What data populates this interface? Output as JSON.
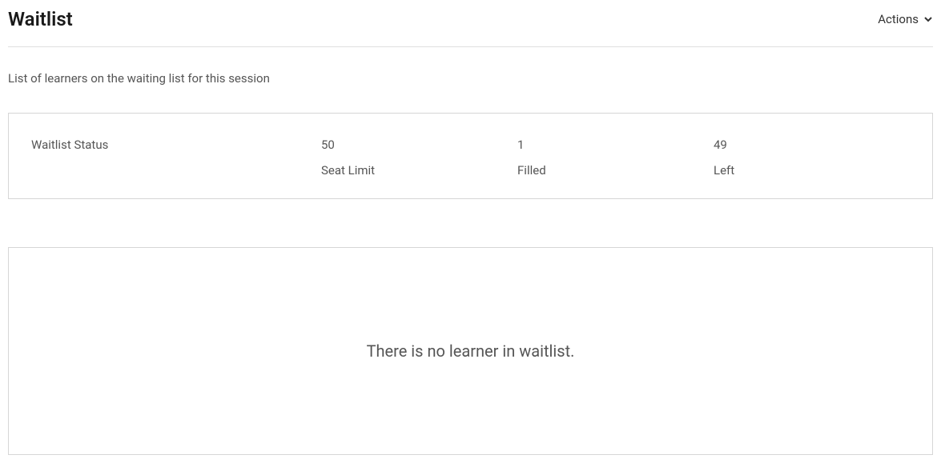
{
  "header": {
    "title": "Waitlist",
    "actions_label": "Actions"
  },
  "description": "List of learners on the waiting list for this session",
  "status": {
    "label": "Waitlist Status",
    "metrics": [
      {
        "value": "50",
        "label": "Seat Limit"
      },
      {
        "value": "1",
        "label": "Filled"
      },
      {
        "value": "49",
        "label": "Left"
      }
    ]
  },
  "empty": {
    "message": "There is no learner in waitlist."
  }
}
